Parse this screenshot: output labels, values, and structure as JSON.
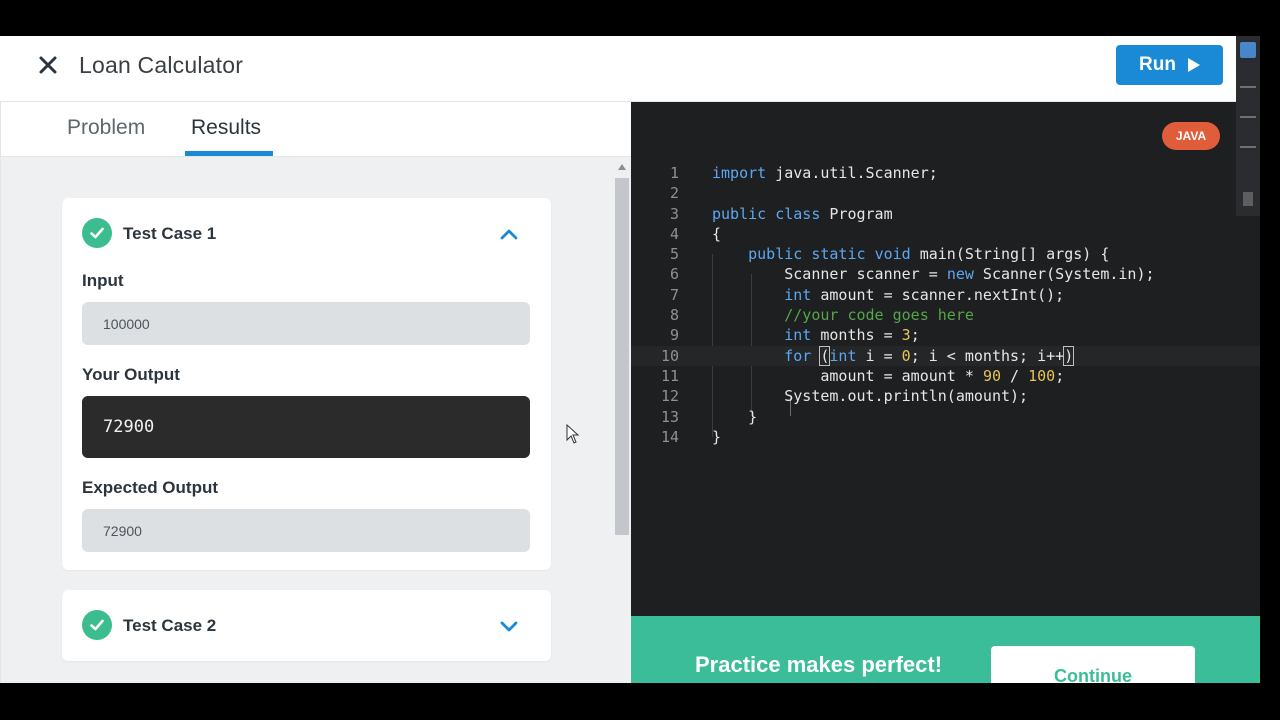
{
  "header": {
    "title": "Loan Calculator",
    "run_label": "Run"
  },
  "tabs": [
    {
      "label": "Problem",
      "active": false
    },
    {
      "label": "Results",
      "active": true
    }
  ],
  "test_cases": [
    {
      "title": "Test Case 1",
      "expanded": true,
      "input_label": "Input",
      "input_value": "100000",
      "output_label": "Your Output",
      "output_value": "72900",
      "expected_label": "Expected Output",
      "expected_value": "72900"
    },
    {
      "title": "Test Case 2",
      "expanded": false
    }
  ],
  "editor": {
    "language": "JAVA",
    "line_numbers": [
      "1",
      "2",
      "3",
      "4",
      "5",
      "6",
      "7",
      "8",
      "9",
      "10",
      "11",
      "12",
      "13",
      "14"
    ]
  },
  "banner": {
    "message": "Practice makes perfect!",
    "continue_label": "Continue"
  },
  "colors": {
    "accent": "#1a8ad6",
    "success": "#3cbd8f",
    "banner": "#3cbd9a",
    "language_badge": "#e05d3a",
    "editor_bg": "#1e1f21"
  },
  "icons": [
    "close-icon",
    "play-icon",
    "check-icon",
    "chevron-up-icon",
    "chevron-down-icon",
    "mouse-cursor-icon"
  ]
}
